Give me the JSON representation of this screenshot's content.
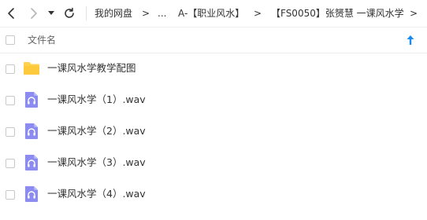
{
  "navigation": {
    "back_icon": "chevron-left-icon",
    "forward_icon": "chevron-right-icon",
    "dropdown_icon": "caret-down-icon",
    "refresh_icon": "refresh-icon",
    "breadcrumbs": [
      "我的网盘",
      "...",
      "A-【职业风水】",
      "【FS0050】张赟慧 一课风水学"
    ],
    "separator": ">"
  },
  "list_header": {
    "name_label": "文件名",
    "sort_icon": "sort-ascending-icon",
    "sort_color": "#1a8cf0"
  },
  "files": [
    {
      "name": "一课风水学教学配图",
      "type": "folder",
      "icon": "folder-icon"
    },
    {
      "name": "一课风水学（1）.wav",
      "type": "audio",
      "icon": "audio-file-icon"
    },
    {
      "name": "一课风水学（2）.wav",
      "type": "audio",
      "icon": "audio-file-icon"
    },
    {
      "name": "一课风水学（3）.wav",
      "type": "audio",
      "icon": "audio-file-icon"
    },
    {
      "name": "一课风水学（4）.wav",
      "type": "audio",
      "icon": "audio-file-icon"
    }
  ],
  "colors": {
    "folder": "#ffd351",
    "audio": "#8c8cf0",
    "accent": "#1a8cf0"
  }
}
